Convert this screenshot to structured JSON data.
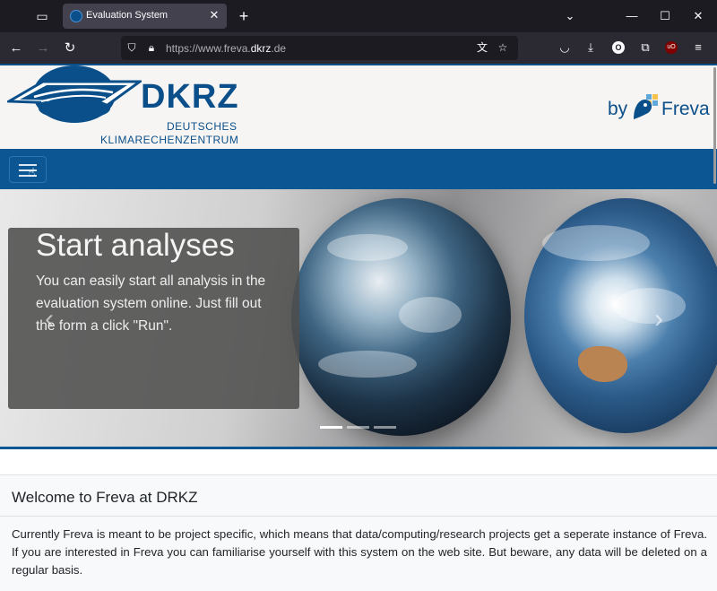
{
  "browser": {
    "tab": {
      "title": "Evaluation System"
    },
    "url": {
      "prefix": "https://www.freva.",
      "domain": "dkrz",
      "suffix": ".de"
    }
  },
  "header": {
    "logo_brand": "DKRZ",
    "logo_sub_line1": "DEUTSCHES",
    "logo_sub_line2": "KLIMARECHENZENTRUM",
    "by_label": "by",
    "freva_label": "Freva"
  },
  "carousel": {
    "slide_title": "Start analyses",
    "slide_text": "You can easily start all analysis in the evaluation system online. Just fill out the form a click \"Run\".",
    "active_index": 0,
    "slide_count": 3
  },
  "content": {
    "heading": "Welcome to Freva at DRKZ",
    "paragraph": "Currently Freva is meant to be project specific, which means that data/computing/research projects get a seperate instance of Freva. If you are interested in Freva you can familiarise yourself with this system on the web site. But beware, any data will be deleted on a regular basis."
  },
  "colors": {
    "brand_blue": "#0b4f8a",
    "menu_bar": "#0b5693",
    "browser_bg": "#1c1b22"
  }
}
